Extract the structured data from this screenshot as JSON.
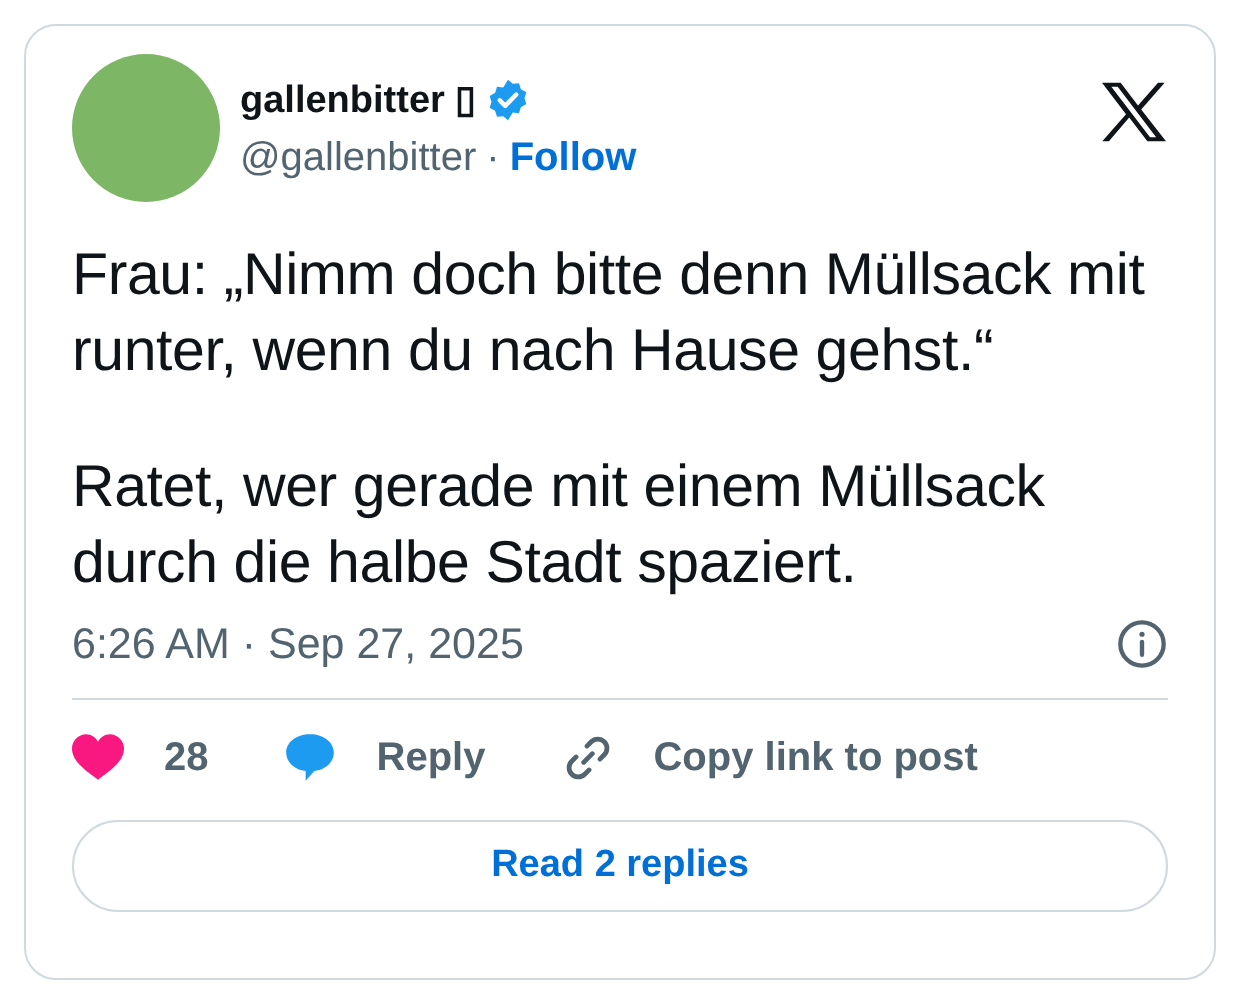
{
  "author": {
    "name": "gallenbitter ▯",
    "verified": true,
    "handle": "@gallenbitter",
    "separator": "·",
    "follow": "Follow"
  },
  "post": {
    "paragraphs": [
      "Frau: „Nimm doch bitte denn Müllsack mit runter, wenn du nach Hause gehst.“",
      "Ratet, wer gerade mit einem Müllsack durch die halbe Stadt spaziert."
    ]
  },
  "timestamp": "6:26 AM · Sep 27, 2025",
  "actions": [
    {
      "kind": "like",
      "label": "28"
    },
    {
      "kind": "reply",
      "label": "Reply"
    },
    {
      "kind": "copy",
      "label": "Copy link to post"
    }
  ],
  "read_replies": "Read 2 replies"
}
